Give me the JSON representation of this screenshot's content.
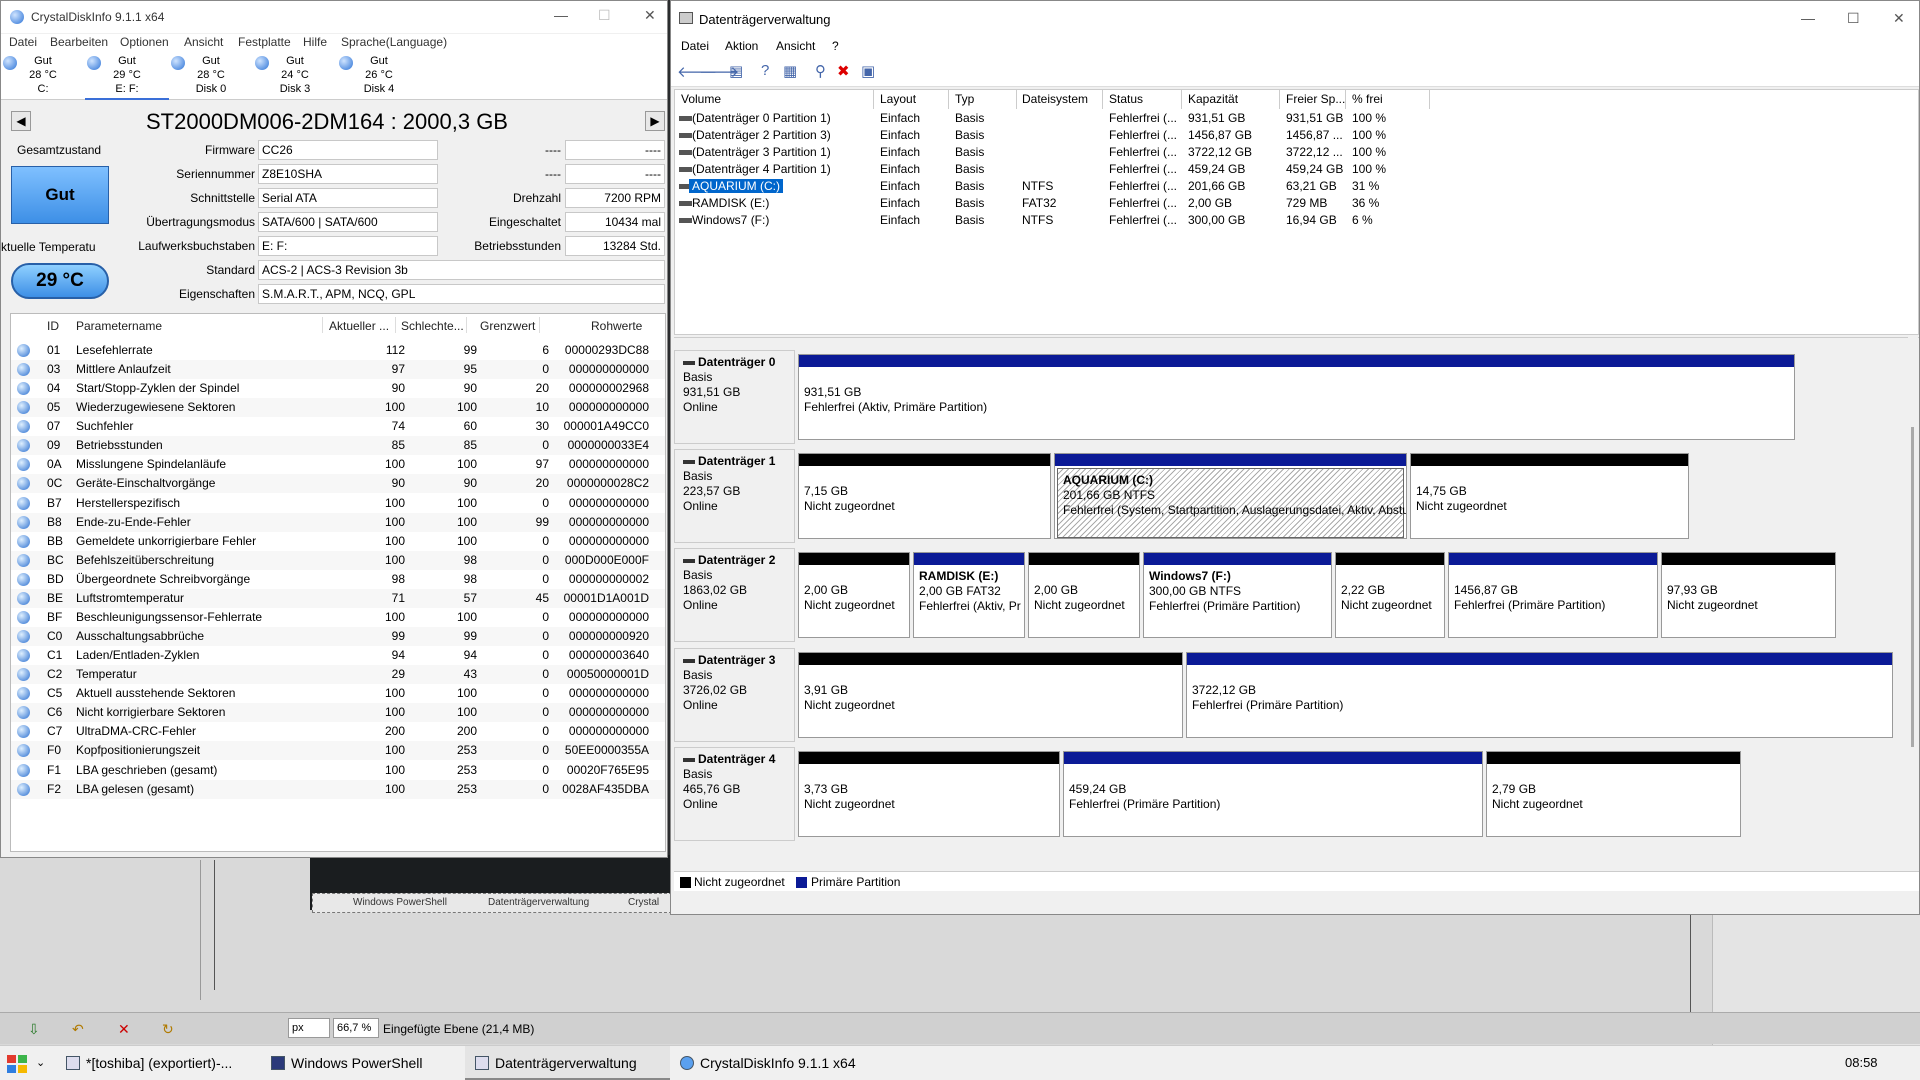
{
  "cdi": {
    "title": "CrystalDiskInfo 9.1.1 x64",
    "menu": [
      "Datei",
      "Bearbeiten",
      "Optionen",
      "Ansicht",
      "Festplatte",
      "Hilfe",
      "Sprache(Language)"
    ],
    "disk_tabs": [
      {
        "status": "Gut",
        "temp": "28 °C",
        "name": "C:"
      },
      {
        "status": "Gut",
        "temp": "29 °C",
        "name": "E: F:"
      },
      {
        "status": "Gut",
        "temp": "28 °C",
        "name": "Disk 0"
      },
      {
        "status": "Gut",
        "temp": "24 °C",
        "name": "Disk 3"
      },
      {
        "status": "Gut",
        "temp": "26 °C",
        "name": "Disk 4"
      }
    ],
    "model": "ST2000DM006-2DM164 : 2000,3 GB",
    "health_label": "Gesamtzustand",
    "health_value": "Gut",
    "temp_label": "ktuelle Temperatu",
    "temp_value": "29 °C",
    "fields": {
      "firmware_label": "Firmware",
      "firmware": "CC26",
      "serial_label": "Seriennummer",
      "serial": "Z8E10SHA",
      "interface_label": "Schnittstelle",
      "interface": "Serial ATA",
      "transfer_label": "Übertragungsmodus",
      "transfer": "SATA/600 | SATA/600",
      "letters_label": "Laufwerksbuchstaben",
      "letters": "E: F:",
      "standard_label": "Standard",
      "standard": "ACS-2 | ACS-3 Revision 3b",
      "features_label": "Eigenschaften",
      "features": "S.M.A.R.T., APM, NCQ, GPL",
      "dash1": "----",
      "dash1_val": "----",
      "dash2": "----",
      "dash2_val": "----",
      "rpm_label": "Drehzahl",
      "rpm": "7200 RPM",
      "poweron_count_label": "Eingeschaltet",
      "poweron_count": "10434 mal",
      "hours_label": "Betriebsstunden",
      "hours": "13284 Std."
    },
    "table_headers": [
      "ID",
      "Parametername",
      "Aktueller ...",
      "Schlechte...",
      "Grenzwert",
      "Rohwerte"
    ],
    "rows": [
      [
        "01",
        "Lesefehlerrate",
        "112",
        "99",
        "6",
        "00000293DC88"
      ],
      [
        "03",
        "Mittlere Anlaufzeit",
        "97",
        "95",
        "0",
        "000000000000"
      ],
      [
        "04",
        "Start/Stopp-Zyklen der Spindel",
        "90",
        "90",
        "20",
        "000000002968"
      ],
      [
        "05",
        "Wiederzugewiesene Sektoren",
        "100",
        "100",
        "10",
        "000000000000"
      ],
      [
        "07",
        "Suchfehler",
        "74",
        "60",
        "30",
        "000001A49CC0"
      ],
      [
        "09",
        "Betriebsstunden",
        "85",
        "85",
        "0",
        "0000000033E4"
      ],
      [
        "0A",
        "Misslungene Spindelanläufe",
        "100",
        "100",
        "97",
        "000000000000"
      ],
      [
        "0C",
        "Geräte-Einschaltvorgänge",
        "90",
        "90",
        "20",
        "0000000028C2"
      ],
      [
        "B7",
        "Herstellerspezifisch",
        "100",
        "100",
        "0",
        "000000000000"
      ],
      [
        "B8",
        "Ende-zu-Ende-Fehler",
        "100",
        "100",
        "99",
        "000000000000"
      ],
      [
        "BB",
        "Gemeldete unkorrigierbare Fehler",
        "100",
        "100",
        "0",
        "000000000000"
      ],
      [
        "BC",
        "Befehlszeitüberschreitung",
        "100",
        "98",
        "0",
        "000D000E000F"
      ],
      [
        "BD",
        "Übergeordnete Schreibvorgänge",
        "98",
        "98",
        "0",
        "000000000002"
      ],
      [
        "BE",
        "Luftstromtemperatur",
        "71",
        "57",
        "45",
        "00001D1A001D"
      ],
      [
        "BF",
        "Beschleunigungssensor-Fehlerrate",
        "100",
        "100",
        "0",
        "000000000000"
      ],
      [
        "C0",
        "Ausschaltungsabbrüche",
        "99",
        "99",
        "0",
        "000000000920"
      ],
      [
        "C1",
        "Laden/Entladen-Zyklen",
        "94",
        "94",
        "0",
        "000000003640"
      ],
      [
        "C2",
        "Temperatur",
        "29",
        "43",
        "0",
        "00050000001D"
      ],
      [
        "C5",
        "Aktuell ausstehende Sektoren",
        "100",
        "100",
        "0",
        "000000000000"
      ],
      [
        "C6",
        "Nicht korrigierbare Sektoren",
        "100",
        "100",
        "0",
        "000000000000"
      ],
      [
        "C7",
        "UltraDMA-CRC-Fehler",
        "200",
        "200",
        "0",
        "000000000000"
      ],
      [
        "F0",
        "Kopfpositionierungszeit",
        "100",
        "253",
        "0",
        "50EE0000355A"
      ],
      [
        "F1",
        "LBA geschrieben (gesamt)",
        "100",
        "253",
        "0",
        "00020F765E95"
      ],
      [
        "F2",
        "LBA gelesen (gesamt)",
        "100",
        "253",
        "0",
        "0028AF435DBA"
      ]
    ]
  },
  "dm": {
    "title": "Datenträgerverwaltung",
    "menu": [
      "Datei",
      "Aktion",
      "Ansicht",
      "?"
    ],
    "vol_headers": [
      "Volume",
      "Layout",
      "Typ",
      "Dateisystem",
      "Status",
      "Kapazität",
      "Freier Sp...",
      "% frei"
    ],
    "volumes": [
      [
        "(Datenträger 0 Partition 1)",
        "Einfach",
        "Basis",
        "",
        "Fehlerfrei (...",
        "931,51 GB",
        "931,51 GB",
        "100 %"
      ],
      [
        "(Datenträger 2 Partition 3)",
        "Einfach",
        "Basis",
        "",
        "Fehlerfrei (...",
        "1456,87 GB",
        "1456,87 ...",
        "100 %"
      ],
      [
        "(Datenträger 3 Partition 1)",
        "Einfach",
        "Basis",
        "",
        "Fehlerfrei (...",
        "3722,12 GB",
        "3722,12 ...",
        "100 %"
      ],
      [
        "(Datenträger 4 Partition 1)",
        "Einfach",
        "Basis",
        "",
        "Fehlerfrei (...",
        "459,24 GB",
        "459,24 GB",
        "100 %"
      ],
      [
        "AQUARIUM (C:)",
        "Einfach",
        "Basis",
        "NTFS",
        "Fehlerfrei (...",
        "201,66 GB",
        "63,21 GB",
        "31 %"
      ],
      [
        "RAMDISK (E:)",
        "Einfach",
        "Basis",
        "FAT32",
        "Fehlerfrei (...",
        "2,00 GB",
        "729 MB",
        "36 %"
      ],
      [
        "Windows7 (F:)",
        "Einfach",
        "Basis",
        "NTFS",
        "Fehlerfrei (...",
        "300,00 GB",
        "16,94 GB",
        "6 %"
      ]
    ],
    "disks": [
      {
        "name": "Datenträger 0",
        "type": "Basis",
        "size": "931,51 GB",
        "state": "Online",
        "parts": [
          {
            "title": "",
            "l1": "931,51 GB",
            "l2": "Fehlerfrei (Aktiv, Primäre Partition)",
            "bar": "blue"
          }
        ]
      },
      {
        "name": "Datenträger 1",
        "type": "Basis",
        "size": "223,57 GB",
        "state": "Online",
        "parts": [
          {
            "title": "",
            "l1": "7,15 GB",
            "l2": "Nicht zugeordnet",
            "bar": "black"
          },
          {
            "title": "AQUARIUM  (C:)",
            "l1": "201,66 GB NTFS",
            "l2": "Fehlerfrei (System, Startpartition, Auslagerungsdatei, Aktiv, Abstu",
            "bar": "blue"
          },
          {
            "title": "",
            "l1": "14,75 GB",
            "l2": "Nicht zugeordnet",
            "bar": "black"
          }
        ]
      },
      {
        "name": "Datenträger 2",
        "type": "Basis",
        "size": "1863,02 GB",
        "state": "Online",
        "parts": [
          {
            "title": "",
            "l1": "2,00 GB",
            "l2": "Nicht zugeordnet",
            "bar": "black"
          },
          {
            "title": "RAMDISK  (E:)",
            "l1": "2,00 GB FAT32",
            "l2": "Fehlerfrei (Aktiv, Pr",
            "bar": "blue"
          },
          {
            "title": "",
            "l1": "2,00 GB",
            "l2": "Nicht zugeordnet",
            "bar": "black"
          },
          {
            "title": "Windows7  (F:)",
            "l1": "300,00 GB NTFS",
            "l2": "Fehlerfrei (Primäre Partition)",
            "bar": "blue"
          },
          {
            "title": "",
            "l1": "2,22 GB",
            "l2": "Nicht zugeordnet",
            "bar": "black"
          },
          {
            "title": "",
            "l1": "1456,87 GB",
            "l2": "Fehlerfrei (Primäre Partition)",
            "bar": "blue"
          },
          {
            "title": "",
            "l1": "97,93 GB",
            "l2": "Nicht zugeordnet",
            "bar": "black"
          }
        ]
      },
      {
        "name": "Datenträger 3",
        "type": "Basis",
        "size": "3726,02 GB",
        "state": "Online",
        "parts": [
          {
            "title": "",
            "l1": "3,91 GB",
            "l2": "Nicht zugeordnet",
            "bar": "black"
          },
          {
            "title": "",
            "l1": "3722,12 GB",
            "l2": "Fehlerfrei (Primäre Partition)",
            "bar": "blue"
          }
        ]
      },
      {
        "name": "Datenträger 4",
        "type": "Basis",
        "size": "465,76 GB",
        "state": "Online",
        "parts": [
          {
            "title": "",
            "l1": "3,73 GB",
            "l2": "Nicht zugeordnet",
            "bar": "black"
          },
          {
            "title": "",
            "l1": "459,24 GB",
            "l2": "Fehlerfrei (Primäre Partition)",
            "bar": "blue"
          },
          {
            "title": "",
            "l1": "2,79 GB",
            "l2": "Nicht zugeordnet",
            "bar": "black"
          }
        ]
      }
    ],
    "legend": {
      "unallocated": "Nicht zugeordnet",
      "primary": "Primäre Partition"
    }
  },
  "editor": {
    "thumbs": [
      "Windows PowerShell",
      "Datenträgerverwaltung",
      "Crystal"
    ],
    "unit": "px",
    "zoom": "66,7 %",
    "status": "Eingefügte Ebene (21,4 MB)"
  },
  "taskbar": {
    "tasks": [
      "*[toshiba] (exportiert)-...",
      "Windows PowerShell",
      "Datenträgerverwaltung",
      "CrystalDiskInfo 9.1.1 x64"
    ],
    "clock": "08:58"
  },
  "colors": {
    "primary_partition": "#0b1a96",
    "unallocated": "#000000",
    "health_good": "#3d8fe6"
  }
}
